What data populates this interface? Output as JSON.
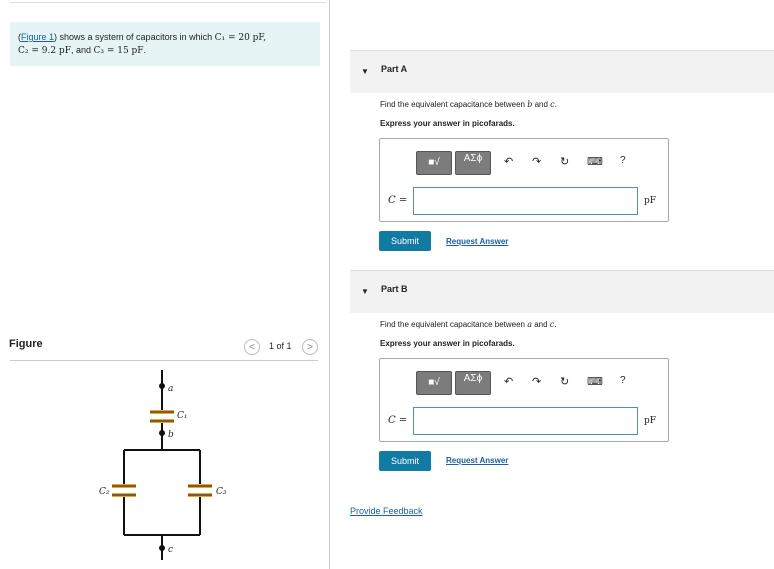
{
  "problem": {
    "link": "Figure 1",
    "text_before": "(",
    "text_after": ") shows a system of capacitors in which ",
    "c1": "C₁ = 20 pF,",
    "c2": "C₂ = 9.2 pF",
    "and": ", and ",
    "c3": "C₃ = 15 pF",
    "end": "."
  },
  "figure": {
    "label": "Figure",
    "pager": "1 of 1",
    "prev": "<",
    "next": ">",
    "node_a": "a",
    "node_b": "b",
    "node_c": "c",
    "cap_top": "C₁",
    "cap_left": "C₂",
    "cap_right": "C₃"
  },
  "parts": [
    {
      "title": "Part A",
      "question_pre": "Find the equivalent capacitance between ",
      "v1": "b",
      "and": " and ",
      "v2": "c",
      "end": ".",
      "express": "Express your answer in picofarads.",
      "eq_label": "C =",
      "unit": "pF",
      "submit": "Submit",
      "request": "Request Answer",
      "input_value": ""
    },
    {
      "title": "Part B",
      "question_pre": "Find the equivalent capacitance between ",
      "v1": "a",
      "and": " and ",
      "v2": "c",
      "end": ".",
      "express": "Express your answer in picofarads.",
      "eq_label": "C =",
      "unit": "pF",
      "submit": "Submit",
      "request": "Request Answer",
      "input_value": ""
    }
  ],
  "toolbar": {
    "template1": "■√",
    "template2": "ΑΣϕ",
    "undo": "↶",
    "redo": "↷",
    "reset": "↻",
    "keyboard": "⌨",
    "help": "?"
  },
  "feedback": "Provide Feedback"
}
